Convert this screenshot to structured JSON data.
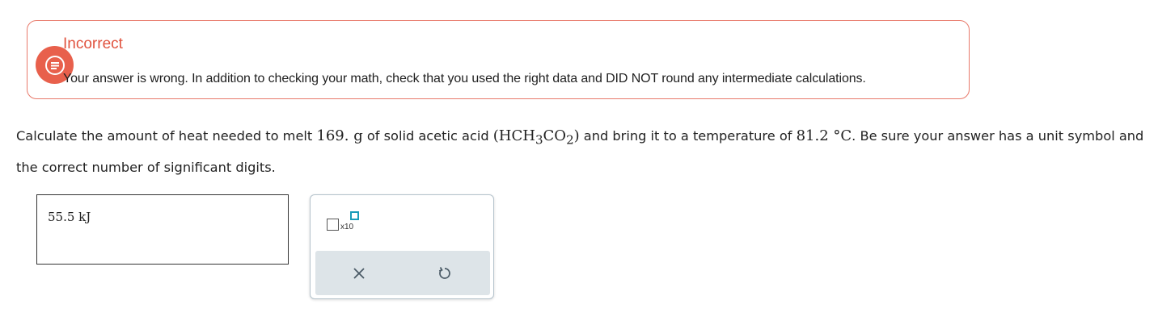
{
  "feedback": {
    "icon": "chat-bubble-icon",
    "title": "Incorrect",
    "message": "Your answer is wrong. In addition to checking your math, check that you used the right data and DID NOT round any intermediate calculations.",
    "accent_color": "#e8604c"
  },
  "question": {
    "part1": "Calculate the amount of heat needed to melt ",
    "mass": "169. g",
    "part2": " of solid acetic acid ",
    "formula_open": "(HCH",
    "formula_sub1": "3",
    "formula_mid": "CO",
    "formula_sub2": "2",
    "formula_close": ")",
    "part3": " and bring it to a temperature of ",
    "temperature": "81.2 °C",
    "part4": ". Be sure your answer has a unit symbol and the correct number of significant digits."
  },
  "answer": {
    "value": "55.5 kJ"
  },
  "tools": {
    "sci_notation_label": "x10",
    "clear_icon": "close-icon",
    "undo_icon": "undo-icon",
    "exponent_color": "#1a9bb8"
  }
}
